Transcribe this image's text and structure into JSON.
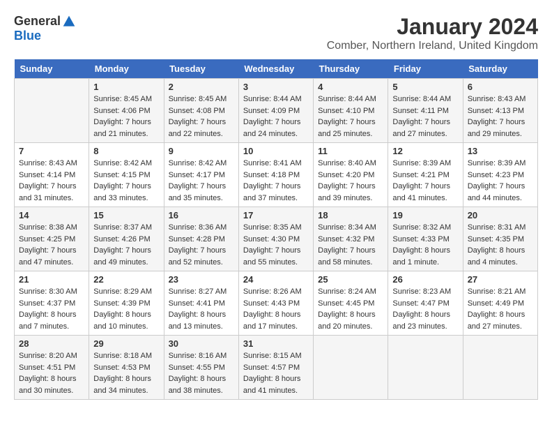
{
  "header": {
    "logo_general": "General",
    "logo_blue": "Blue",
    "month": "January 2024",
    "location": "Comber, Northern Ireland, United Kingdom"
  },
  "days_of_week": [
    "Sunday",
    "Monday",
    "Tuesday",
    "Wednesday",
    "Thursday",
    "Friday",
    "Saturday"
  ],
  "weeks": [
    [
      {
        "num": "",
        "sunrise": "",
        "sunset": "",
        "daylight": ""
      },
      {
        "num": "1",
        "sunrise": "Sunrise: 8:45 AM",
        "sunset": "Sunset: 4:06 PM",
        "daylight": "Daylight: 7 hours and 21 minutes."
      },
      {
        "num": "2",
        "sunrise": "Sunrise: 8:45 AM",
        "sunset": "Sunset: 4:08 PM",
        "daylight": "Daylight: 7 hours and 22 minutes."
      },
      {
        "num": "3",
        "sunrise": "Sunrise: 8:44 AM",
        "sunset": "Sunset: 4:09 PM",
        "daylight": "Daylight: 7 hours and 24 minutes."
      },
      {
        "num": "4",
        "sunrise": "Sunrise: 8:44 AM",
        "sunset": "Sunset: 4:10 PM",
        "daylight": "Daylight: 7 hours and 25 minutes."
      },
      {
        "num": "5",
        "sunrise": "Sunrise: 8:44 AM",
        "sunset": "Sunset: 4:11 PM",
        "daylight": "Daylight: 7 hours and 27 minutes."
      },
      {
        "num": "6",
        "sunrise": "Sunrise: 8:43 AM",
        "sunset": "Sunset: 4:13 PM",
        "daylight": "Daylight: 7 hours and 29 minutes."
      }
    ],
    [
      {
        "num": "7",
        "sunrise": "Sunrise: 8:43 AM",
        "sunset": "Sunset: 4:14 PM",
        "daylight": "Daylight: 7 hours and 31 minutes."
      },
      {
        "num": "8",
        "sunrise": "Sunrise: 8:42 AM",
        "sunset": "Sunset: 4:15 PM",
        "daylight": "Daylight: 7 hours and 33 minutes."
      },
      {
        "num": "9",
        "sunrise": "Sunrise: 8:42 AM",
        "sunset": "Sunset: 4:17 PM",
        "daylight": "Daylight: 7 hours and 35 minutes."
      },
      {
        "num": "10",
        "sunrise": "Sunrise: 8:41 AM",
        "sunset": "Sunset: 4:18 PM",
        "daylight": "Daylight: 7 hours and 37 minutes."
      },
      {
        "num": "11",
        "sunrise": "Sunrise: 8:40 AM",
        "sunset": "Sunset: 4:20 PM",
        "daylight": "Daylight: 7 hours and 39 minutes."
      },
      {
        "num": "12",
        "sunrise": "Sunrise: 8:39 AM",
        "sunset": "Sunset: 4:21 PM",
        "daylight": "Daylight: 7 hours and 41 minutes."
      },
      {
        "num": "13",
        "sunrise": "Sunrise: 8:39 AM",
        "sunset": "Sunset: 4:23 PM",
        "daylight": "Daylight: 7 hours and 44 minutes."
      }
    ],
    [
      {
        "num": "14",
        "sunrise": "Sunrise: 8:38 AM",
        "sunset": "Sunset: 4:25 PM",
        "daylight": "Daylight: 7 hours and 47 minutes."
      },
      {
        "num": "15",
        "sunrise": "Sunrise: 8:37 AM",
        "sunset": "Sunset: 4:26 PM",
        "daylight": "Daylight: 7 hours and 49 minutes."
      },
      {
        "num": "16",
        "sunrise": "Sunrise: 8:36 AM",
        "sunset": "Sunset: 4:28 PM",
        "daylight": "Daylight: 7 hours and 52 minutes."
      },
      {
        "num": "17",
        "sunrise": "Sunrise: 8:35 AM",
        "sunset": "Sunset: 4:30 PM",
        "daylight": "Daylight: 7 hours and 55 minutes."
      },
      {
        "num": "18",
        "sunrise": "Sunrise: 8:34 AM",
        "sunset": "Sunset: 4:32 PM",
        "daylight": "Daylight: 7 hours and 58 minutes."
      },
      {
        "num": "19",
        "sunrise": "Sunrise: 8:32 AM",
        "sunset": "Sunset: 4:33 PM",
        "daylight": "Daylight: 8 hours and 1 minute."
      },
      {
        "num": "20",
        "sunrise": "Sunrise: 8:31 AM",
        "sunset": "Sunset: 4:35 PM",
        "daylight": "Daylight: 8 hours and 4 minutes."
      }
    ],
    [
      {
        "num": "21",
        "sunrise": "Sunrise: 8:30 AM",
        "sunset": "Sunset: 4:37 PM",
        "daylight": "Daylight: 8 hours and 7 minutes."
      },
      {
        "num": "22",
        "sunrise": "Sunrise: 8:29 AM",
        "sunset": "Sunset: 4:39 PM",
        "daylight": "Daylight: 8 hours and 10 minutes."
      },
      {
        "num": "23",
        "sunrise": "Sunrise: 8:27 AM",
        "sunset": "Sunset: 4:41 PM",
        "daylight": "Daylight: 8 hours and 13 minutes."
      },
      {
        "num": "24",
        "sunrise": "Sunrise: 8:26 AM",
        "sunset": "Sunset: 4:43 PM",
        "daylight": "Daylight: 8 hours and 17 minutes."
      },
      {
        "num": "25",
        "sunrise": "Sunrise: 8:24 AM",
        "sunset": "Sunset: 4:45 PM",
        "daylight": "Daylight: 8 hours and 20 minutes."
      },
      {
        "num": "26",
        "sunrise": "Sunrise: 8:23 AM",
        "sunset": "Sunset: 4:47 PM",
        "daylight": "Daylight: 8 hours and 23 minutes."
      },
      {
        "num": "27",
        "sunrise": "Sunrise: 8:21 AM",
        "sunset": "Sunset: 4:49 PM",
        "daylight": "Daylight: 8 hours and 27 minutes."
      }
    ],
    [
      {
        "num": "28",
        "sunrise": "Sunrise: 8:20 AM",
        "sunset": "Sunset: 4:51 PM",
        "daylight": "Daylight: 8 hours and 30 minutes."
      },
      {
        "num": "29",
        "sunrise": "Sunrise: 8:18 AM",
        "sunset": "Sunset: 4:53 PM",
        "daylight": "Daylight: 8 hours and 34 minutes."
      },
      {
        "num": "30",
        "sunrise": "Sunrise: 8:16 AM",
        "sunset": "Sunset: 4:55 PM",
        "daylight": "Daylight: 8 hours and 38 minutes."
      },
      {
        "num": "31",
        "sunrise": "Sunrise: 8:15 AM",
        "sunset": "Sunset: 4:57 PM",
        "daylight": "Daylight: 8 hours and 41 minutes."
      },
      {
        "num": "",
        "sunrise": "",
        "sunset": "",
        "daylight": ""
      },
      {
        "num": "",
        "sunrise": "",
        "sunset": "",
        "daylight": ""
      },
      {
        "num": "",
        "sunrise": "",
        "sunset": "",
        "daylight": ""
      }
    ]
  ]
}
